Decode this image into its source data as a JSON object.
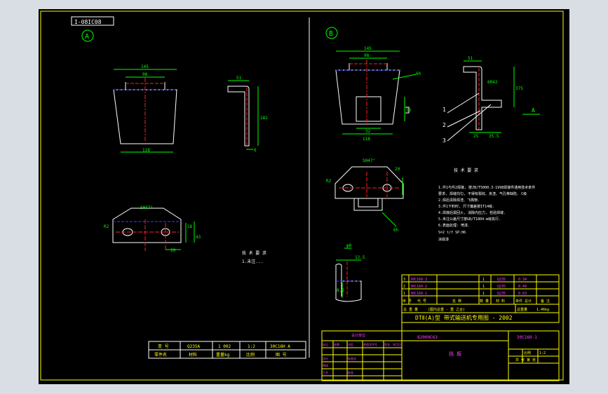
{
  "drawing": {
    "doc_number_box": "I-08IC08",
    "view_a_label": "A",
    "view_b_label": "B",
    "view_a_arrow_label": "A"
  },
  "view_a": {
    "dims": {
      "top_width": "145",
      "inner_width": "98",
      "bottom_width": "118",
      "profile_top": "51",
      "profile_height": "182",
      "profile_thk": "6",
      "plan_width": "SH47°",
      "plan_r": "R2",
      "plan_h1": "18",
      "plan_h2": "43",
      "plan_b": "20"
    },
    "note_title": "技 术 要 求",
    "note_line": "1.未注..."
  },
  "view_b": {
    "dims": {
      "top_width": "145",
      "inner_width": "98",
      "bottom_width": "118",
      "slot_width": "32",
      "side_h": "56",
      "weld": "6h",
      "profile_top": "51",
      "profile_h": "375",
      "profile_a": "25",
      "profile_b": "35.5",
      "profile_r": "6R42",
      "plan_width": "SH47°",
      "plan_r": "R2",
      "plan_20": "20",
      "plan_6h": "6h",
      "detail_phi": "φ8",
      "detail_w": "12.5",
      "detail_h": "8.5"
    },
    "callouts": [
      "1",
      "2",
      "3"
    ]
  },
  "notes": {
    "title": "技 术 要 求",
    "lines": [
      "1.件1与件2焊接, 按JB/T5000.3-1998焊接件通用技术条件",
      "  要求, 焊缝均匀, 不得有裂纹、夹渣、气孔等缺陷. C级",
      "2.焊后清除焊渣、飞溅物.",
      "3.件1下料时, 尺寸偏差按IT14级.",
      "4.焊接后需回火, 消除内应力, 检验焊缝.",
      "5.未注公差尺寸按GB/T1804-m级执行.",
      "6.表面处理: 喷漆.",
      "S=2 t/f  SP.H6",
      "  涂底漆"
    ]
  },
  "small_table_left": {
    "row1": [
      "变 号",
      "Q235A",
      "1 002",
      "1:2",
      "30C16H A"
    ],
    "row2": [
      "零件名",
      "材料",
      "重量kg",
      "比例",
      "图 号"
    ]
  },
  "title_block": {
    "parts": [
      {
        "no": "3",
        "code": "30C160-3",
        "name": "",
        "qty": "1",
        "mat": "Q235",
        "wt": "0.34",
        "note": ""
      },
      {
        "no": "2",
        "code": "30C160-2",
        "name": "",
        "qty": "1",
        "mat": "Q235",
        "wt": "0.49",
        "note": ""
      },
      {
        "no": "1",
        "code": "30C160-1",
        "name": "",
        "qty": "1",
        "mat": "Q235",
        "wt": "0.63",
        "note": ""
      }
    ],
    "header": [
      "序 号",
      "代 号",
      "名 称",
      "数 量",
      "材 料",
      "单件 总计",
      "备 注"
    ],
    "weight_row": [
      "总 重 量",
      "(图内总重 - 重 之合)",
      "总重量",
      "1.46kg"
    ],
    "project_title": "DTⅡ(A)型 带式输送机专用图 - 2002",
    "drawing_no_left": "82000C63",
    "drawing_no_right": "30C160-1",
    "part_name": "挡 板",
    "company": "设计单位",
    "revision_rows": [
      [
        "标记",
        "处数",
        "分区",
        "更改文件号",
        "签名",
        "年月日"
      ],
      [
        "设计",
        "",
        "标准化",
        "",
        "",
        ""
      ],
      [
        "审核",
        "",
        "",
        "",
        "",
        ""
      ],
      [
        "工艺",
        "",
        "批准",
        "",
        "",
        ""
      ]
    ],
    "scale_label": "比例",
    "scale_value": "1:2",
    "sheet_label": "共 张 第 张"
  },
  "colors": {
    "frame": "#ffff00",
    "line": "#ffffff",
    "center": "#ff2020",
    "dim": "#00ff00",
    "hidden": "#4040ff",
    "text_mag": "#ff40ff"
  }
}
